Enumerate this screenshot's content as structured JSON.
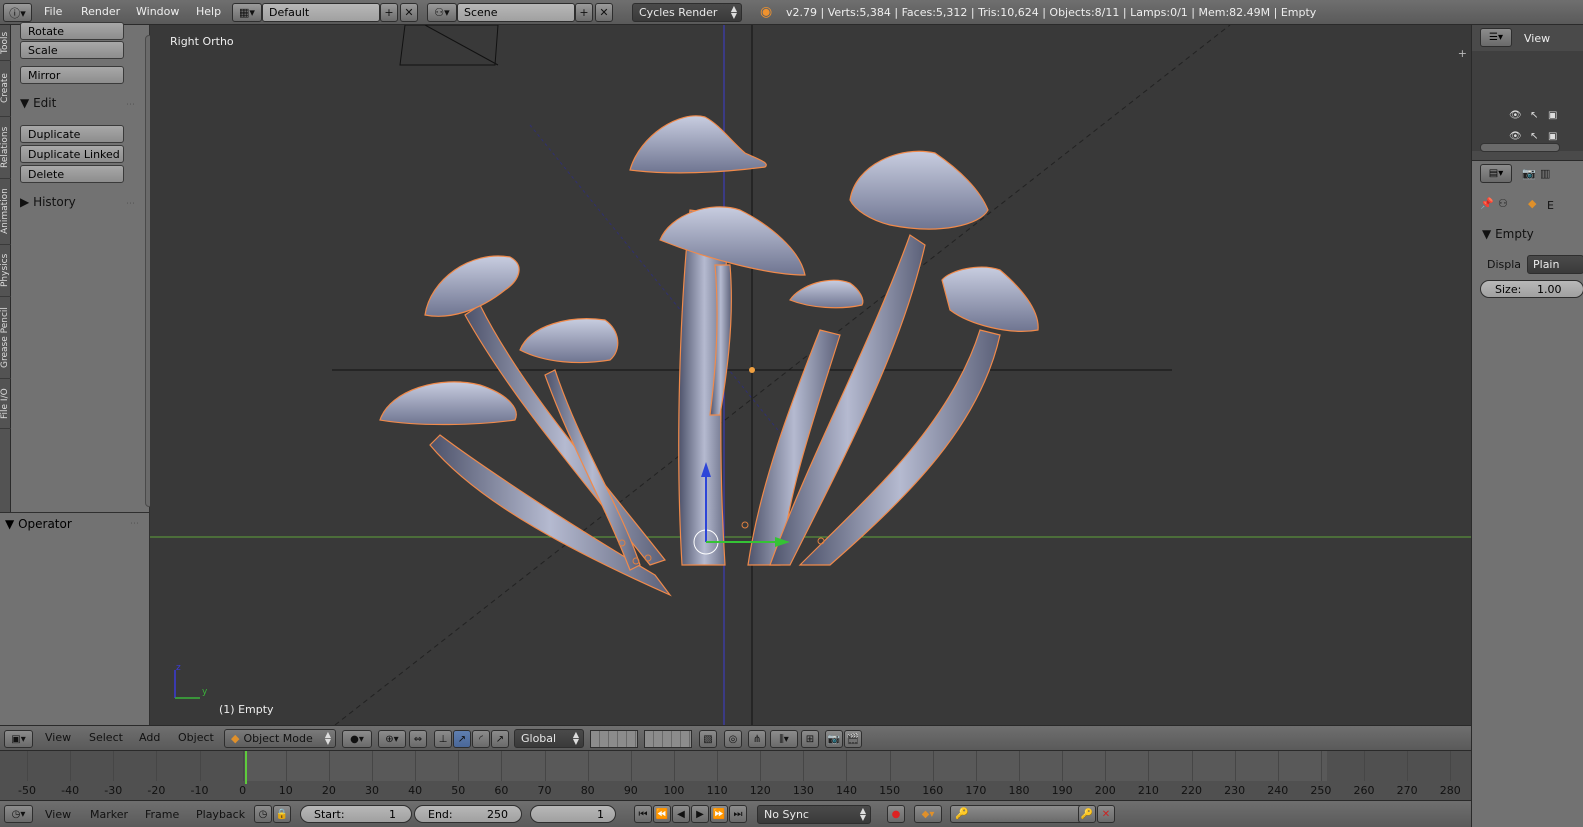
{
  "topbar": {
    "menus": [
      "File",
      "Render",
      "Window",
      "Help"
    ],
    "screen_layout": "Default",
    "scene": "Scene",
    "render_engine": "Cycles Render",
    "stats": "v2.79 | Verts:5,384 | Faces:5,312 | Tris:10,624 | Objects:8/11 | Lamps:0/1 | Mem:82.49M | Empty"
  },
  "toolshelf": {
    "tabs": [
      "Tools",
      "Create",
      "Relations",
      "Animation",
      "Physics",
      "Grease Pencil",
      "File I/O"
    ],
    "transform_buttons": [
      "Rotate",
      "Scale"
    ],
    "mirror": "Mirror",
    "edit_panel": "Edit",
    "edit_buttons": [
      "Duplicate",
      "Duplicate Linked",
      "Delete"
    ],
    "history_panel": "History"
  },
  "operator": {
    "label": "Operator"
  },
  "viewport": {
    "view_name": "Right Ortho",
    "active_object": "(1) Empty",
    "axis_z": "z",
    "axis_y": "y",
    "colors": {
      "background": "#393939",
      "mesh": "#a8aec8",
      "outline": "#f08a4b",
      "grid_y": "#5ea33a",
      "grid_z": "#3d3dd0"
    }
  },
  "outliner": {
    "view_menu": "View"
  },
  "properties": {
    "context": "E",
    "panel": "Empty",
    "display_label": "Displa",
    "display_value": "Plain",
    "size_label": "Size:",
    "size_value": "1.00"
  },
  "vp_header": {
    "menus": [
      "View",
      "Select",
      "Add",
      "Object"
    ],
    "mode": "Object Mode",
    "orientation": "Global"
  },
  "timeline": {
    "ticks": [
      "-50",
      "-40",
      "-30",
      "-20",
      "-10",
      "0",
      "10",
      "20",
      "30",
      "40",
      "50",
      "60",
      "70",
      "80",
      "90",
      "100",
      "110",
      "120",
      "130",
      "140",
      "150",
      "160",
      "170",
      "180",
      "190",
      "200",
      "210",
      "220",
      "230",
      "240",
      "250",
      "260",
      "270",
      "280"
    ],
    "current_frame_marker": "1"
  },
  "tl_header": {
    "menus": [
      "View",
      "Marker",
      "Frame",
      "Playback"
    ],
    "start_label": "Start:",
    "start_value": "1",
    "end_label": "End:",
    "end_value": "250",
    "current_frame": "1",
    "sync": "No Sync"
  }
}
